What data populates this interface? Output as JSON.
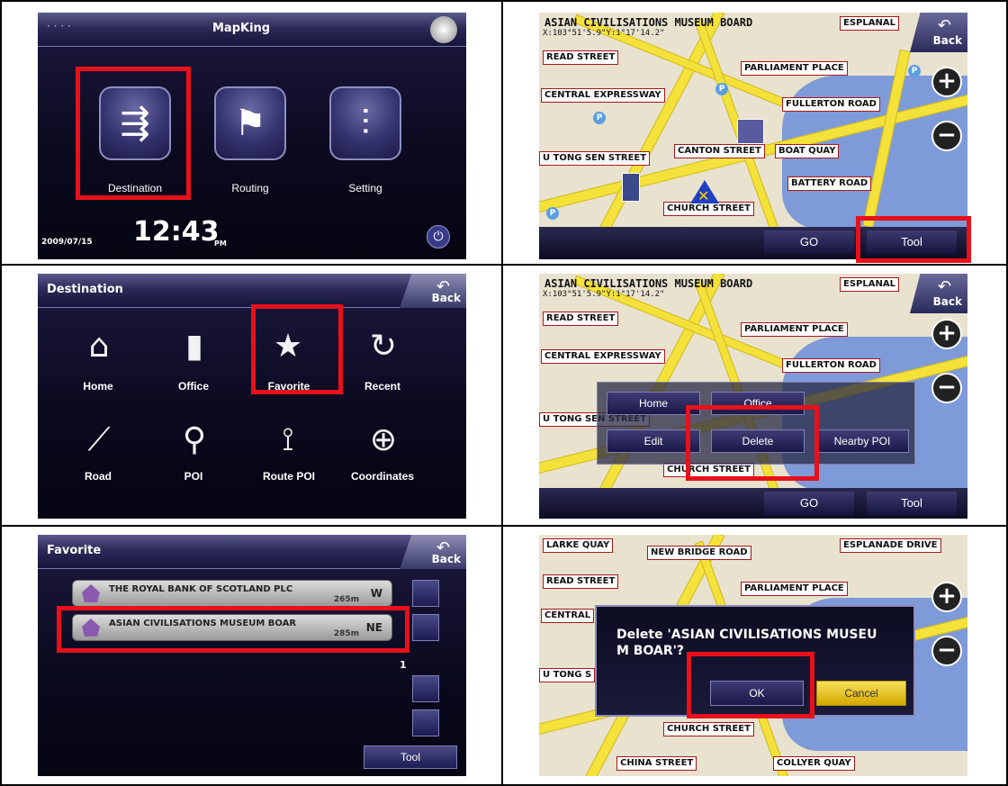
{
  "main_menu": {
    "title": "MapKing",
    "items": [
      {
        "label": "Destination",
        "icon": "signpost-icon"
      },
      {
        "label": "Routing",
        "icon": "road-flag-icon"
      },
      {
        "label": "Setting",
        "icon": "sliders-icon"
      }
    ],
    "date": "2009/07/15",
    "time": "12:43",
    "ampm": "PM"
  },
  "destination_menu": {
    "title": "Destination",
    "back_label": "Back",
    "items": [
      {
        "label": "Home"
      },
      {
        "label": "Office"
      },
      {
        "label": "Favorite"
      },
      {
        "label": "Recent"
      },
      {
        "label": "Road"
      },
      {
        "label": "POI"
      },
      {
        "label": "Route POI"
      },
      {
        "label": "Coordinates"
      }
    ]
  },
  "favorite_list": {
    "title": "Favorite",
    "back_label": "Back",
    "rows": [
      {
        "name": "THE ROYAL BANK OF SCOTLAND PLC",
        "distance": "265m",
        "direction": "W"
      },
      {
        "name": "ASIAN CIVILISATIONS MUSEUM BOAR",
        "distance": "285m",
        "direction": "NE"
      }
    ],
    "page": "1",
    "tool_label": "Tool"
  },
  "map_view": {
    "header_text": "ASIAN CIVILISATIONS MUSEUM BOARD",
    "coords": "X:103°51'5.9\"Y:1°17'14.2\"",
    "back_label": "Back",
    "go_label": "GO",
    "tool_label": "Tool",
    "streets": {
      "larke_quay": "LARKE QUAY",
      "new_bridge_road": "NEW BRIDGE ROAD",
      "esplanade": "ESPLANAL",
      "esplanade_drive": "ESPLANADE DRIVE",
      "read_street": "READ STREET",
      "parliament_place": "PARLIAMENT PLACE",
      "central_expressway": "CENTRAL EXPRESSWAY",
      "central": "CENTRAL",
      "fullerton_road": "FULLERTON ROAD",
      "canton_street": "CANTON STREET",
      "boat_quay": "BOAT QUAY",
      "u_tong_sen_street": "U TONG SEN STREET",
      "u_tong_s": "U TONG S",
      "battery_road": "BATTERY ROAD",
      "church_street": "CHURCH STREET",
      "china_street": "CHINA STREET",
      "collyer_quay": "COLLYER QUAY"
    }
  },
  "tool_popup": {
    "buttons": [
      "Home",
      "Office",
      "Edit",
      "Delete",
      "Nearby POI"
    ]
  },
  "delete_dialog": {
    "message": "Delete 'ASIAN CIVILISATIONS MUSEU M BOAR'?",
    "ok_label": "OK",
    "cancel_label": "Cancel"
  },
  "colors": {
    "highlight": "#e8101a",
    "map_road": "#f4e23a",
    "map_water": "#7e9ad8",
    "label_border": "#a41818"
  }
}
